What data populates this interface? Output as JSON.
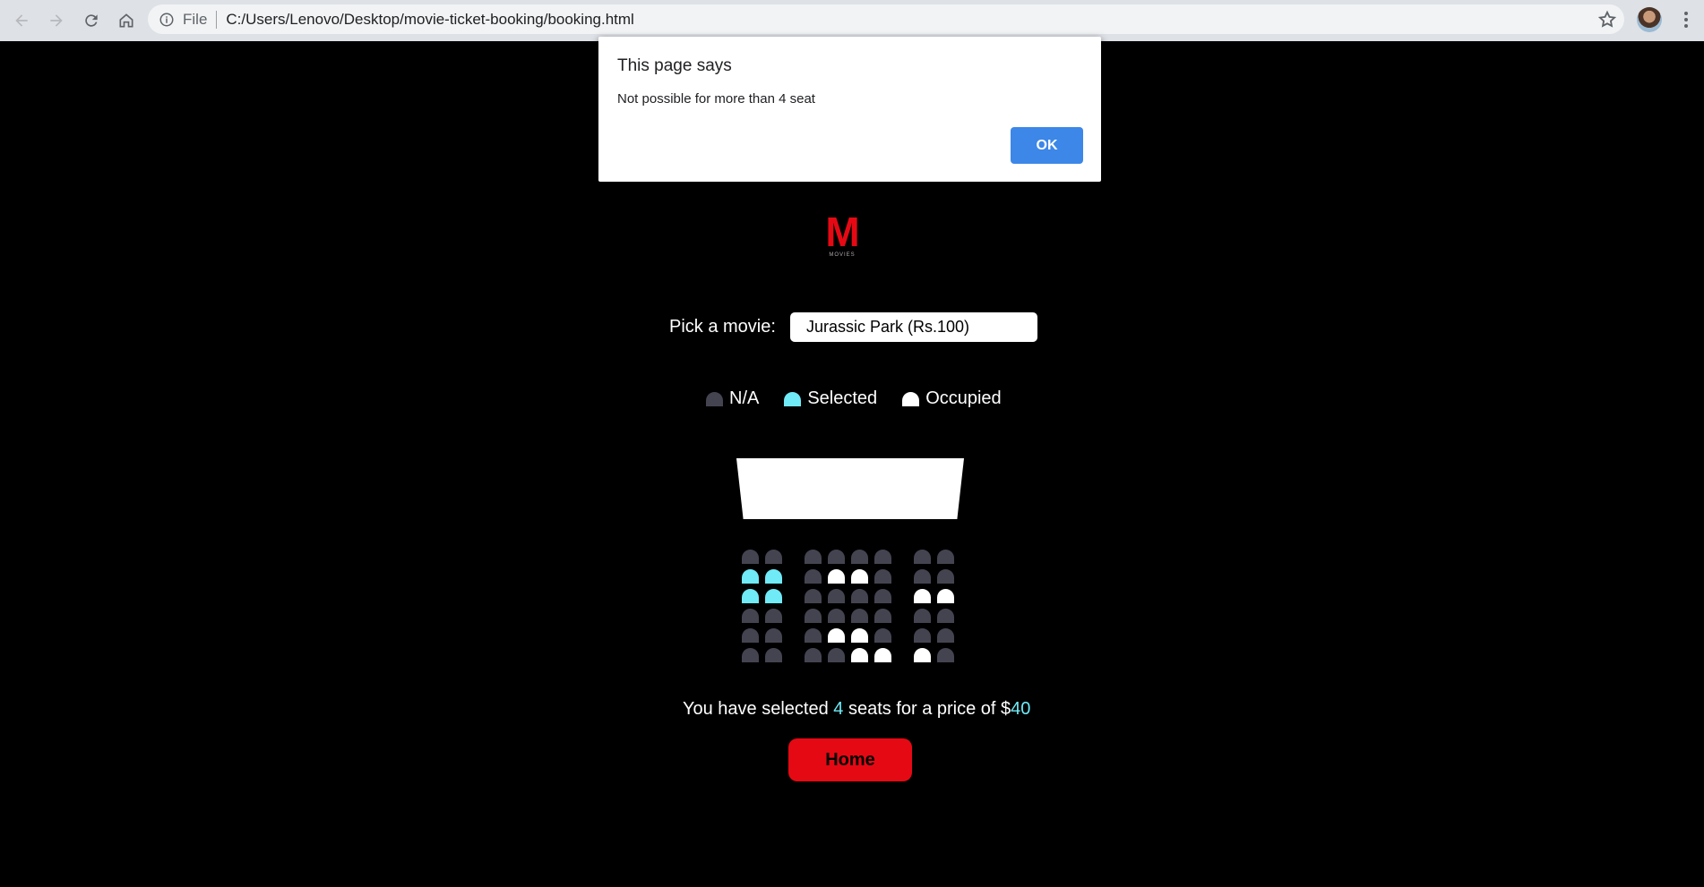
{
  "browser": {
    "scheme": "File",
    "url": "C:/Users/Lenovo/Desktop/movie-ticket-booking/booking.html"
  },
  "dialog": {
    "title": "This page says",
    "message": "Not possible for more than 4 seat",
    "ok_label": "OK"
  },
  "logo": {
    "mark": "M",
    "sub": "MOVIES"
  },
  "picker": {
    "label": "Pick a movie:",
    "selected": "Jurassic Park (Rs.100)"
  },
  "legend": [
    {
      "label": "N/A",
      "state": "na"
    },
    {
      "label": "Selected",
      "state": "selected"
    },
    {
      "label": "Occupied",
      "state": "occupied"
    }
  ],
  "seat_rows": [
    [
      "na",
      "na",
      "|",
      "na",
      "na",
      "na",
      "na",
      "|",
      "na",
      "na"
    ],
    [
      "selected",
      "selected",
      "|",
      "na",
      "occupied",
      "occupied",
      "na",
      "|",
      "na",
      "na"
    ],
    [
      "selected",
      "selected",
      "|",
      "na",
      "na",
      "na",
      "na",
      "|",
      "occupied",
      "occupied"
    ],
    [
      "na",
      "na",
      "|",
      "na",
      "na",
      "na",
      "na",
      "|",
      "na",
      "na"
    ],
    [
      "na",
      "na",
      "|",
      "na",
      "occupied",
      "occupied",
      "na",
      "|",
      "na",
      "na"
    ],
    [
      "na",
      "na",
      "|",
      "na",
      "na",
      "occupied",
      "occupied",
      "|",
      "occupied",
      "na"
    ]
  ],
  "summary": {
    "prefix": "You have selected ",
    "count": "4",
    "middle": " seats for a price of $",
    "price": "40"
  },
  "home_label": "Home",
  "colors": {
    "accent": "#e50914",
    "selected": "#6feaf6",
    "na": "#444451",
    "occupied": "#ffffff"
  }
}
